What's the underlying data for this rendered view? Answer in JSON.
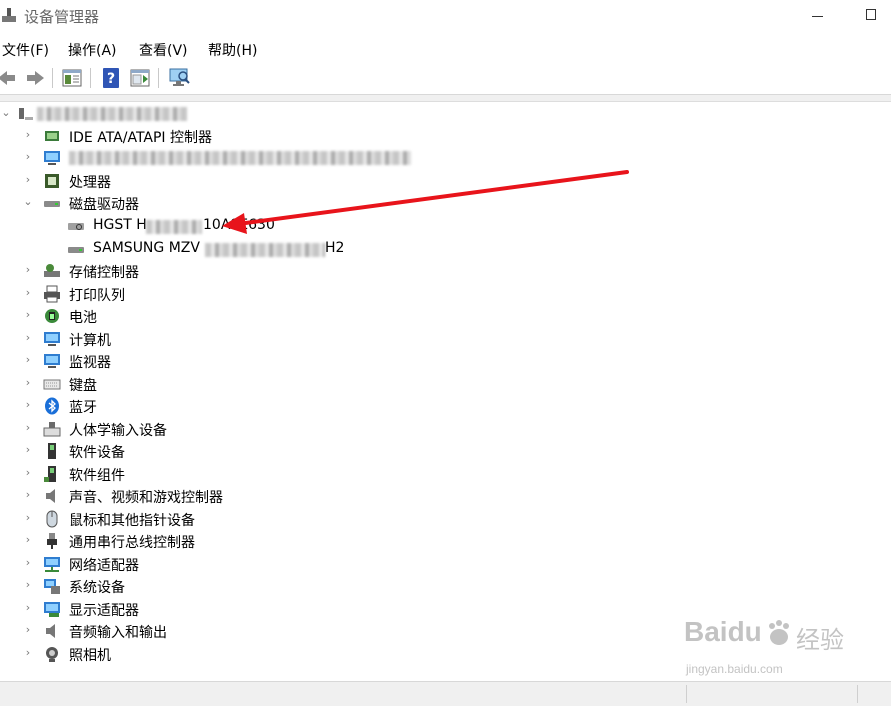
{
  "window": {
    "title": "设备管理器"
  },
  "menu": {
    "file": "文件(F)",
    "action": "操作(A)",
    "view": "查看(V)",
    "help": "帮助(H)"
  },
  "toolbar": {
    "items": [
      "back-icon",
      "forward-icon",
      "properties-icon",
      "help-icon",
      "action-pane-icon",
      "scan-hardware-icon"
    ]
  },
  "tree": {
    "root_label": "",
    "categories": [
      {
        "label": "IDE ATA/ATAPI 控制器",
        "icon": "ide-controller-icon",
        "expanded": false
      },
      {
        "label": "",
        "icon": "computer-icon",
        "expanded": false
      },
      {
        "label": "处理器",
        "icon": "processor-icon",
        "expanded": false
      },
      {
        "label": "磁盘驱动器",
        "icon": "disk-drive-icon",
        "expanded": true,
        "children": [
          {
            "label": "HGST H",
            "suffix": "10A9E630",
            "icon": "disk-icon"
          },
          {
            "label": "SAMSUNG MZV",
            "suffix": "H2",
            "icon": "disk-icon"
          }
        ]
      },
      {
        "label": "存储控制器",
        "icon": "storage-controller-icon",
        "expanded": false
      },
      {
        "label": "打印队列",
        "icon": "printer-icon",
        "expanded": false
      },
      {
        "label": "电池",
        "icon": "battery-icon",
        "expanded": false
      },
      {
        "label": "计算机",
        "icon": "computer-icon",
        "expanded": false
      },
      {
        "label": "监视器",
        "icon": "monitor-icon",
        "expanded": false
      },
      {
        "label": "键盘",
        "icon": "keyboard-icon",
        "expanded": false
      },
      {
        "label": "蓝牙",
        "icon": "bluetooth-icon",
        "expanded": false
      },
      {
        "label": "人体学输入设备",
        "icon": "hid-icon",
        "expanded": false
      },
      {
        "label": "软件设备",
        "icon": "software-device-icon",
        "expanded": false
      },
      {
        "label": "软件组件",
        "icon": "software-component-icon",
        "expanded": false
      },
      {
        "label": "声音、视频和游戏控制器",
        "icon": "speaker-icon",
        "expanded": false
      },
      {
        "label": "鼠标和其他指针设备",
        "icon": "mouse-icon",
        "expanded": false
      },
      {
        "label": "通用串行总线控制器",
        "icon": "usb-icon",
        "expanded": false
      },
      {
        "label": "网络适配器",
        "icon": "network-adapter-icon",
        "expanded": false
      },
      {
        "label": "系统设备",
        "icon": "system-device-icon",
        "expanded": false
      },
      {
        "label": "显示适配器",
        "icon": "display-adapter-icon",
        "expanded": false
      },
      {
        "label": "音频输入和输出",
        "icon": "audio-io-icon",
        "expanded": false
      },
      {
        "label": "照相机",
        "icon": "camera-icon",
        "expanded": false
      }
    ]
  },
  "annotation": {
    "color": "#e8141b",
    "icon": "red-arrow-icon"
  },
  "watermark": {
    "brand": "Baidu",
    "brand_cn": "经验",
    "url": "jingyan.baidu.com"
  }
}
